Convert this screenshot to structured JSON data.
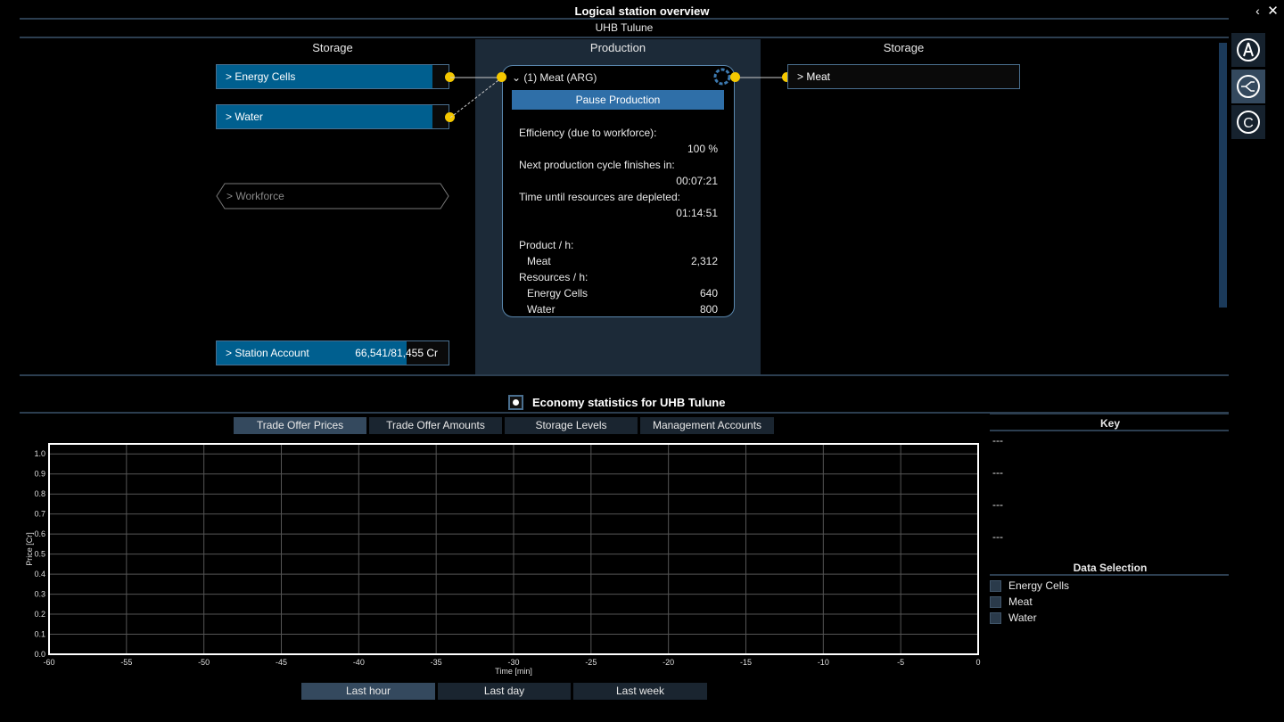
{
  "window": {
    "title": "Logical station overview",
    "station": "UHB Tulune"
  },
  "columns": {
    "left": "Storage",
    "middle": "Production",
    "right": "Storage"
  },
  "inputs": [
    {
      "label": "> Energy Cells",
      "fill": 0.93
    },
    {
      "label": "> Water",
      "fill": 0.93
    }
  ],
  "workforce": "> Workforce",
  "account": {
    "label": "> Station Account",
    "value": "66,541/81,455 Cr",
    "fill": 0.82
  },
  "production": {
    "title": "(1) Meat (ARG)",
    "pause": "Pause Production",
    "eff_label": "Efficiency (due to workforce):",
    "eff_value": "100 %",
    "cycle_label": "Next production cycle finishes in:",
    "cycle_value": "00:07:21",
    "deplete_label": "Time until resources are depleted:",
    "deplete_value": "01:14:51",
    "product_label": "Product / h:",
    "product_name": "Meat",
    "product_value": "2,312",
    "res_label": "Resources / h:",
    "res": [
      {
        "name": "Energy Cells",
        "value": "640"
      },
      {
        "name": "Water",
        "value": "800"
      }
    ]
  },
  "outputs": [
    {
      "label": "> Meat"
    }
  ],
  "economy": {
    "title": "Economy statistics for UHB Tulune",
    "tabs": [
      "Trade Offer Prices",
      "Trade Offer Amounts",
      "Storage Levels",
      "Management Accounts"
    ],
    "active_tab": 0,
    "ranges": [
      "Last hour",
      "Last day",
      "Last week"
    ],
    "active_range": 0
  },
  "key": {
    "title": "Key",
    "entries": [
      "---",
      "---",
      "---",
      "---"
    ]
  },
  "data_selection": {
    "title": "Data Selection",
    "items": [
      "Energy Cells",
      "Meat",
      "Water"
    ]
  },
  "colors": {
    "accent": "#005f8f",
    "connector": "#f5c800",
    "production_bg": "#1c2a38"
  },
  "chart_data": {
    "type": "line",
    "xlabel": "Time [min]",
    "ylabel": "Price [Cr]",
    "xlim": [
      -60,
      0
    ],
    "ylim": [
      0,
      1.05
    ],
    "xticks": [
      -60,
      -55,
      -50,
      -45,
      -40,
      -35,
      -30,
      -25,
      -20,
      -15,
      -10,
      -5,
      0
    ],
    "yticks": [
      "0.0",
      "0.1",
      "0.2",
      "0.3",
      "0.4",
      "0.5",
      "0.6",
      "0.7",
      "0.8",
      "0.9",
      "1.0"
    ],
    "grid": true,
    "series": []
  }
}
